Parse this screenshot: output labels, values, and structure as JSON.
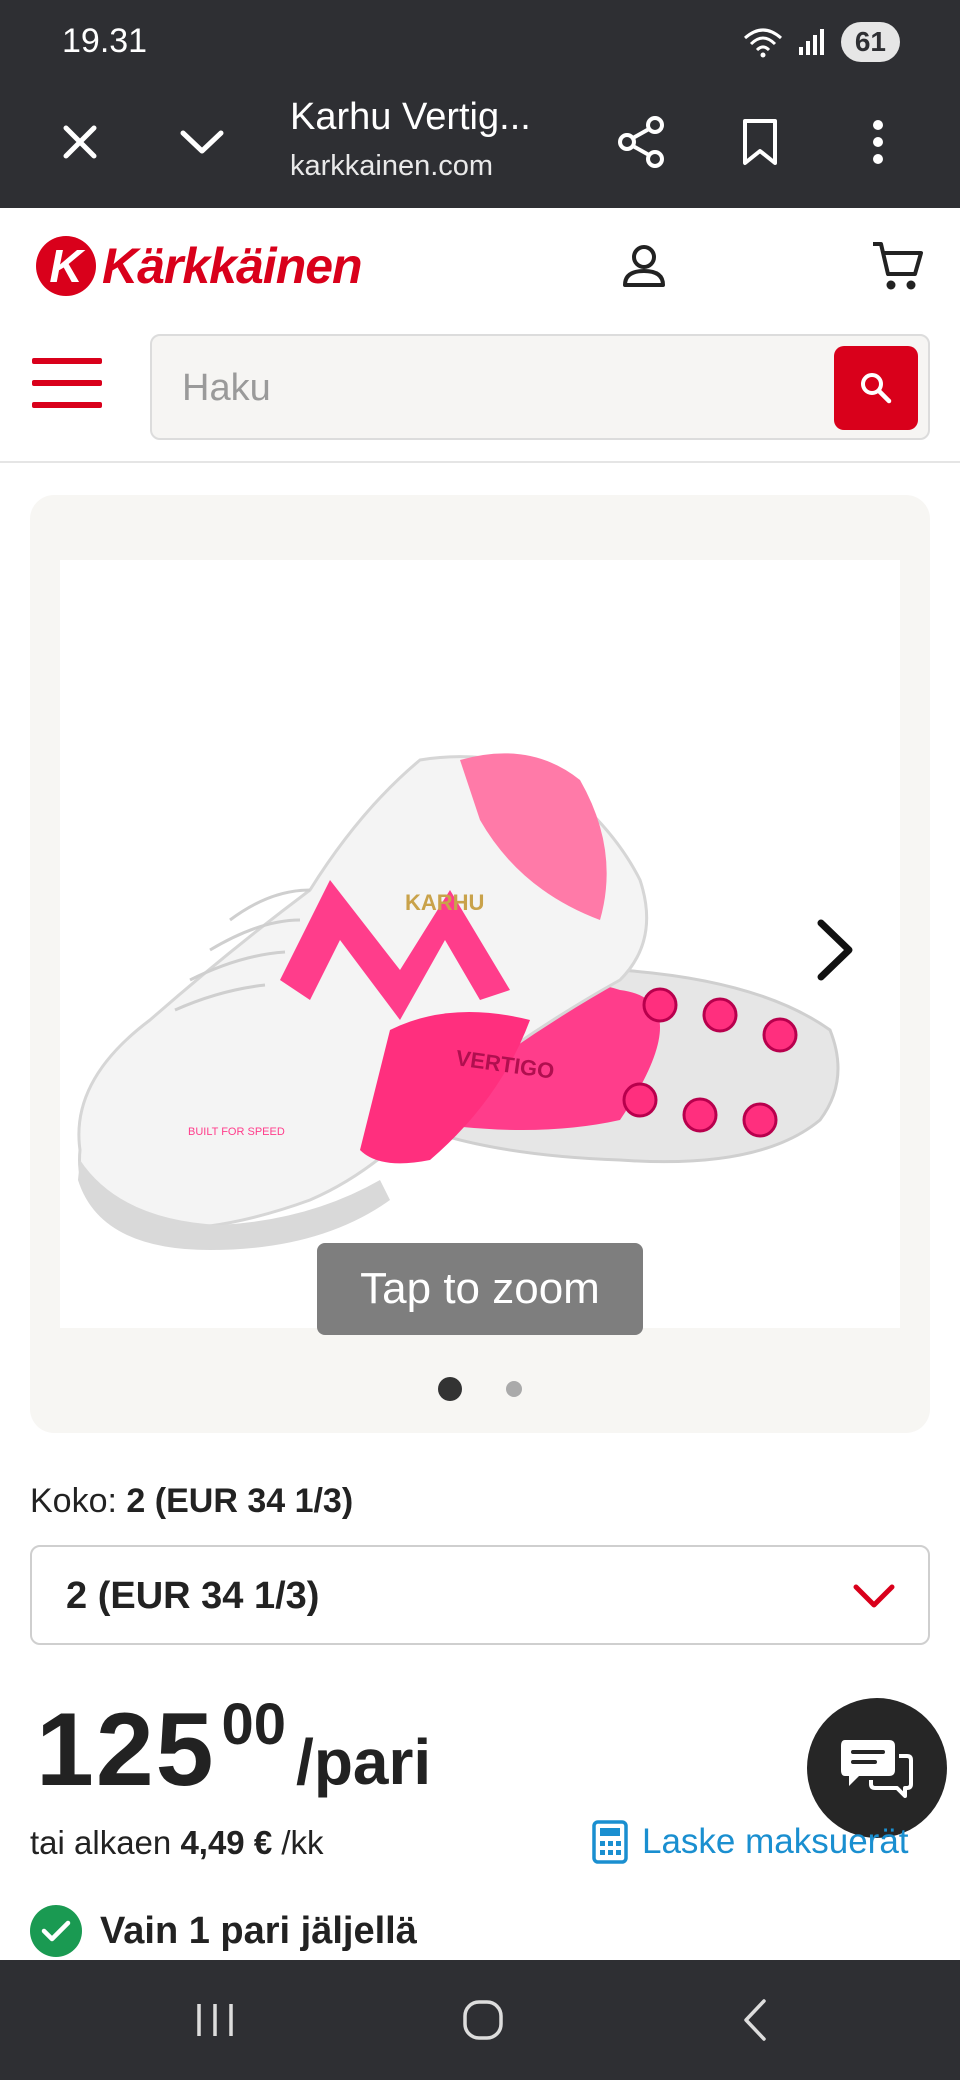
{
  "status_bar": {
    "time": "19.31",
    "battery": "61",
    "icons": [
      "wifi-icon",
      "signal-icon",
      "battery-icon"
    ]
  },
  "browser": {
    "page_title": "Karhu Vertig...",
    "url": "karkkainen.com",
    "icons": [
      "close-icon",
      "chevron-down-icon",
      "share-icon",
      "bookmark-icon",
      "more-vert-icon"
    ]
  },
  "header": {
    "logo_mark": "K",
    "logo_text": "Kärkkäinen",
    "icons": [
      "account-icon",
      "cart-icon",
      "menu-icon"
    ],
    "brand_color": "#d9001b"
  },
  "search": {
    "placeholder": "Haku",
    "value": ""
  },
  "gallery": {
    "zoom_hint": "Tap to zoom",
    "image_count": 2,
    "active_index": 0,
    "shoe_text": {
      "brand": "KARHU",
      "model": "VERTIGO",
      "tagline": "BUILT FOR SPEED"
    }
  },
  "size": {
    "label": "Koko:",
    "selected": "2 (EUR 34 1/3)"
  },
  "price": {
    "integer": "125",
    "decimals": "00",
    "unit": "/pari"
  },
  "installment": {
    "prefix": "tai alkaen",
    "amount": "4,49 €",
    "suffix": "/kk",
    "link_label": "Laske maksuerät",
    "link_color": "#1a8fd0"
  },
  "stock": {
    "text": "Vain 1 pari jäljellä",
    "status_color": "#1a9a52"
  },
  "android_nav": {
    "icons": [
      "recents-icon",
      "home-icon",
      "back-icon"
    ]
  }
}
